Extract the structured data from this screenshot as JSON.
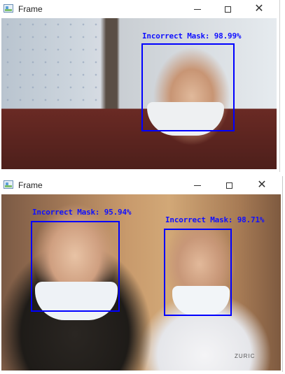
{
  "windows": [
    {
      "title": "Frame",
      "detections": [
        {
          "label": "Incorrect Mask: 98.99%",
          "color": "#0000ff"
        }
      ]
    },
    {
      "title": "Frame",
      "detections": [
        {
          "label": "Incorrect Mask: 95.94%",
          "color": "#0000ff"
        },
        {
          "label": "Incorrect Mask: 98.71%",
          "color": "#0000ff"
        }
      ],
      "shirt_brand": "ZURIC"
    }
  ],
  "icons": {
    "app": "frame-app-icon",
    "minimize": "minimize-icon",
    "maximize": "maximize-icon",
    "close": "close-icon"
  },
  "close_glyph": "✕"
}
